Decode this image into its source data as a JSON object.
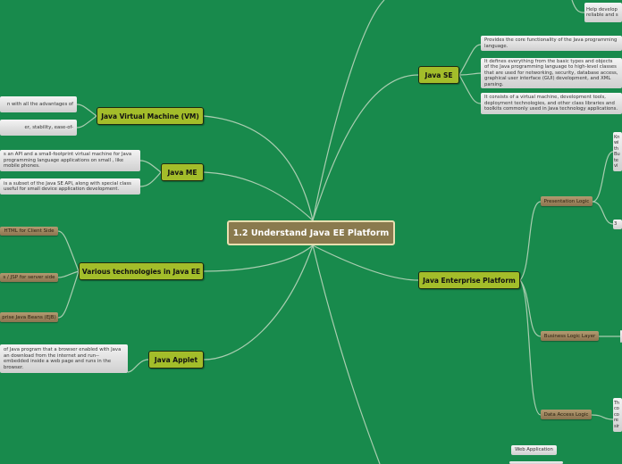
{
  "center": "1.2 Understand Java EE Platform",
  "branches": {
    "jvm": {
      "label": "Java Virtual Machine (VM)",
      "notes": [
        "n with all the advantages of",
        "er, stability, ease-of-"
      ]
    },
    "javame": {
      "label": "Java ME",
      "notes": [
        "s an API and a small-footprint virtual machine for Java programming language applications on small , like mobile phones.",
        "is a subset of the Java SE API, along with special class useful for small device application development."
      ]
    },
    "tech": {
      "label": "Various technologies in Java EE",
      "items": [
        "HTML for Client Side",
        "s / JSP for server side",
        "prise Java Beans (EJB)"
      ]
    },
    "applet": {
      "label": "Java Applet",
      "notes": [
        "of Java program that a browser enabled with Java an download from the internet and run-- embedded inside a web page and runs in the browser."
      ]
    },
    "javase": {
      "label": "Java SE",
      "notes": [
        "Provides the core functionality of the Java programming language.",
        "It defines everything from the basic types and objects of the Java programming language to high-level classes that are used for networking, security, database access, graphical user interface (GUI) development, and XML parsing.",
        "It consists of a virtual machine, development tools, deployment technologies, and other class libraries and toolkits commonly used in Java technology applications."
      ]
    },
    "top": {
      "notes": [
        "Help develop reliable and s"
      ]
    },
    "jep": {
      "label": "Java Enterprise Platform",
      "items": [
        {
          "label": "Presentation Logic",
          "notes": [
            "Kn wi th Bu te vi",
            "3"
          ]
        },
        {
          "label": "Business Logic Layer",
          "notes": [
            ""
          ]
        },
        {
          "label": "Data Access Logic",
          "notes": [
            "Th co co re sir"
          ]
        }
      ]
    },
    "bottom": {
      "items": [
        "Web Application",
        ""
      ]
    }
  },
  "colors": {
    "background": "#188a4c",
    "main_node": "#a3bd2a",
    "center_node": "#8a7a4e",
    "sub_node": "#a08a60",
    "line": "#9fc8a8"
  }
}
